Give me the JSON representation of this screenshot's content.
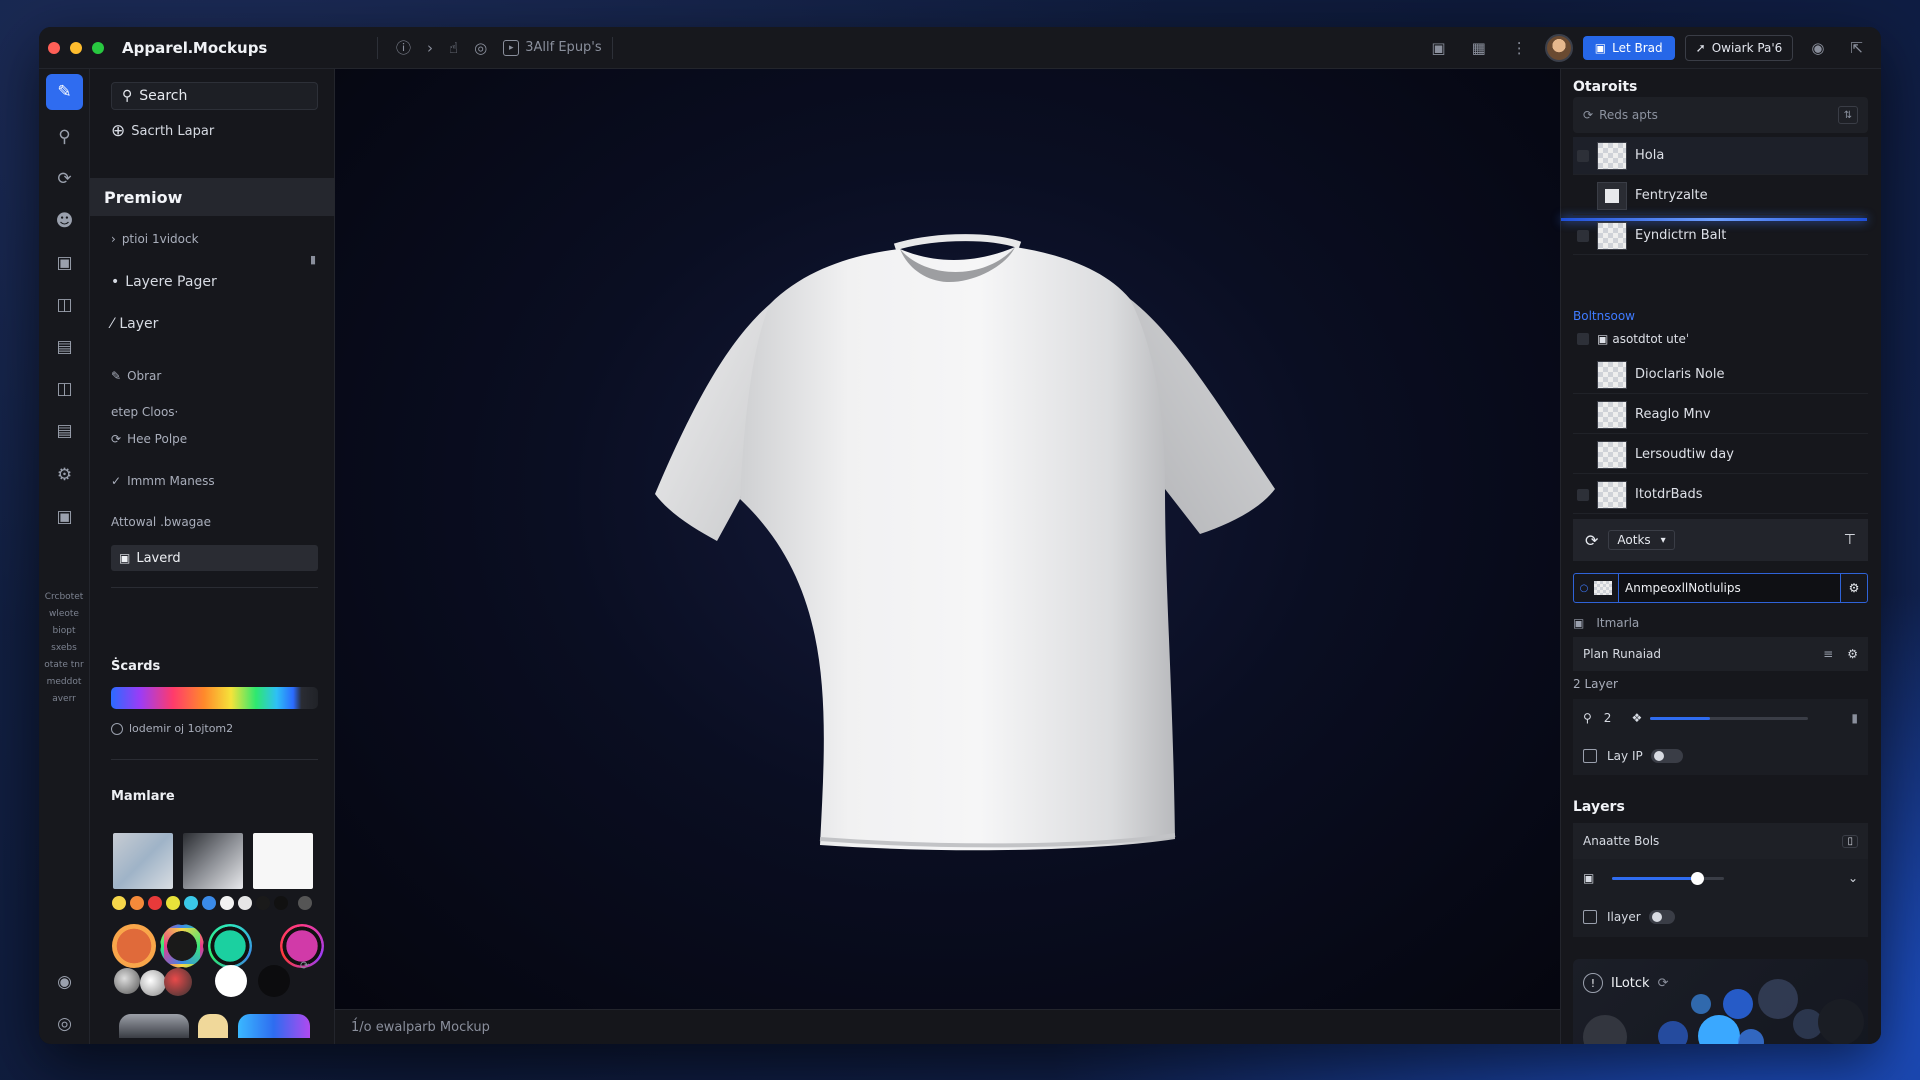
{
  "titlebar": {
    "app_title": "Apparel․Mockups",
    "chip_label": "3Allf Epup's",
    "primary_button": "Let Brad",
    "secondary_button": "Owiark Pa'6"
  },
  "left_panel": {
    "search_placeholder": "Search",
    "add_label": "Sacrth Lapar",
    "section_header": "Premiow",
    "items": [
      "ptioi 1vidock",
      "Layere Pager",
      "Layer",
      "Obrar",
      "etep Cloos·",
      "Hee Polpe",
      "Immm Maness",
      "Attowal .bwagae"
    ],
    "selected_layer": "Laverd",
    "swatches_title": "Ṡcards",
    "gradient_caption": "lodemir oj 1ojtom2",
    "materials_title": "Mamlare"
  },
  "rail": {
    "tiny_labels": [
      "Crcbotet",
      "wleote",
      "biopt",
      "sxebs",
      "otate tnr",
      "meddot",
      "averr"
    ]
  },
  "canvas": {
    "footer_text": "1́/o ewalparb Mockup"
  },
  "right_panel": {
    "title": "Otaroits",
    "search_placeholder": "Reds apts",
    "layers_a": [
      "Hola",
      "Fentryzalte",
      "Eyndictrn Balt"
    ],
    "group_label": "Boltnsoow",
    "group_item": "asotdtot uteˈ",
    "layers_b": [
      "Dioclaris Nole",
      "Reaglo Mnv",
      "Lersoudtiw day",
      "ItotdrBads"
    ],
    "toolbar_select": "Aotks",
    "input_value": "AnmpeoxllNotlulips",
    "meta_label": "Itmarla",
    "prop_label": "Plan Runaiad",
    "layer_count_label": "2 Layer",
    "layer_count_value": "2",
    "lay_toggle_label": "Lay IP",
    "layers_title": "Layers",
    "annotate_label": "Anaatte Bols",
    "layer_toggle_label": "Ilayer",
    "lock_label": "ILotck"
  },
  "controls": {
    "slider_1": 0.38,
    "slider_2": 0.76
  },
  "colors": {
    "accent": "#2f6cf0",
    "window_bg": "#131418",
    "panel_bg": "#16171c"
  }
}
